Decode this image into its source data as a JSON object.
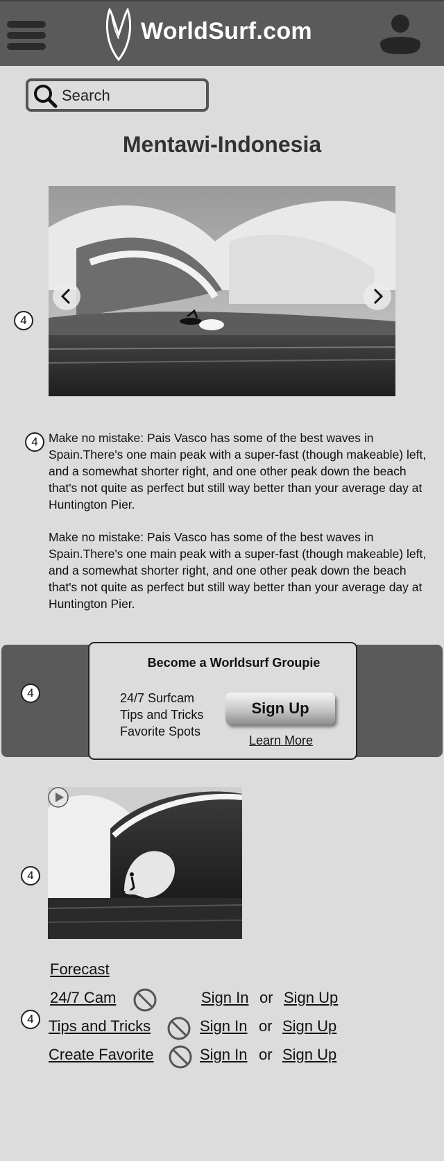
{
  "header": {
    "brand": "WorldSurf.com",
    "menu_icon": "hamburger-menu-icon",
    "logo_icon": "surfboard-logo-icon",
    "profile_icon": "user-profile-icon"
  },
  "search": {
    "placeholder": "Search",
    "icon": "search-icon"
  },
  "page_title": "Mentawi-Indonesia",
  "annotation_badge": "4",
  "hero_carousel": {
    "prev_icon": "chevron-left-icon",
    "next_icon": "chevron-right-icon"
  },
  "description": {
    "paragraphs": [
      "Make no mistake: Pais Vasco has some of the best waves in Spain.There's one main peak with a super-fast (though makeable) left, and a somewhat shorter right, and one other peak down the beach that's not quite as perfect but still way better than your average day at Huntington Pier.",
      "Make no mistake: Pais Vasco has some of the best waves in Spain.There's one main peak with a super-fast (though makeable) left, and a somewhat shorter right, and one other peak down the beach that's not quite as perfect but still way better than your average day at Huntington Pier."
    ]
  },
  "promo": {
    "title": "Become a Worldsurf Groupie",
    "features": [
      "24/7 Surfcam",
      "Tips and Tricks",
      "Favorite Spots"
    ],
    "signup_label": "Sign Up",
    "learn_more_label": "Learn More"
  },
  "video": {
    "play_icon": "play-icon"
  },
  "links": {
    "forecast": "Forecast",
    "rows": [
      {
        "label": "24/7 Cam",
        "sign_in": "Sign In ",
        "or": "or",
        "sign_up": "Sign Up"
      },
      {
        "label": "Tips and Tricks",
        "sign_in": "Sign In ",
        "or": "or",
        "sign_up": "Sign Up"
      },
      {
        "label": "Create Favorite",
        "sign_in": "Sign In ",
        "or": "or",
        "sign_up": "Sign Up"
      }
    ],
    "locked_icon": "prohibited-icon"
  },
  "colors": {
    "header_bg": "#5a5a5a",
    "page_bg": "#dcdcdc",
    "band_bg": "#5a5a5a"
  }
}
